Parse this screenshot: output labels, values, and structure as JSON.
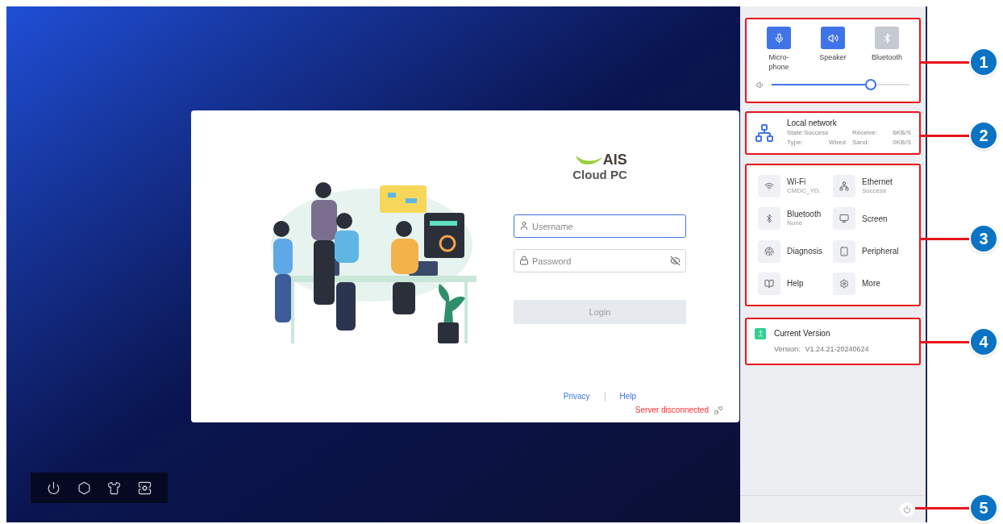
{
  "login": {
    "logo": {
      "brand": "AIS",
      "product": "Cloud PC"
    },
    "username": {
      "placeholder": "Username",
      "focused": true
    },
    "password": {
      "placeholder": "Password"
    },
    "login_button": {
      "label": "Login",
      "disabled": true
    },
    "links": [
      {
        "label": "Privacy"
      },
      {
        "label": "Help"
      }
    ],
    "server_status": "Server disconnected"
  },
  "panel": {
    "toggles": [
      {
        "kind": "microphone",
        "label": "Micro-\nphone",
        "on": true
      },
      {
        "kind": "speaker",
        "label": "Speaker",
        "on": true
      },
      {
        "kind": "bluetooth",
        "label": "Bluetooth",
        "on": false
      }
    ],
    "volume": {
      "level": 0.72
    },
    "network": {
      "title": "Local network",
      "rows": [
        {
          "left": [
            "State:Success"
          ],
          "right": [
            "Receive:",
            "6KB/S"
          ]
        },
        {
          "left": [
            "Type:",
            "Wired"
          ],
          "right": [
            "Sand:",
            "0KB/S"
          ]
        }
      ]
    },
    "tiles": [
      {
        "kind": "wifi",
        "title": "Wi-Fi",
        "subtitle": "CMDC_YD."
      },
      {
        "kind": "ethernet",
        "title": "Ethernet",
        "subtitle": "Success"
      },
      {
        "kind": "bluetooth",
        "title": "Bluetooth",
        "subtitle": "None"
      },
      {
        "kind": "screen",
        "title": "Screen"
      },
      {
        "kind": "diagnosis",
        "title": "Diagnosis"
      },
      {
        "kind": "peripheral",
        "title": "Peripheral"
      },
      {
        "kind": "help",
        "title": "Help"
      },
      {
        "kind": "more",
        "title": "More"
      }
    ],
    "version": {
      "title": "Current Version",
      "label": "Version:",
      "value": "V1.24.21-20240624"
    }
  },
  "callouts": [
    "1",
    "2",
    "3",
    "4",
    "5"
  ]
}
